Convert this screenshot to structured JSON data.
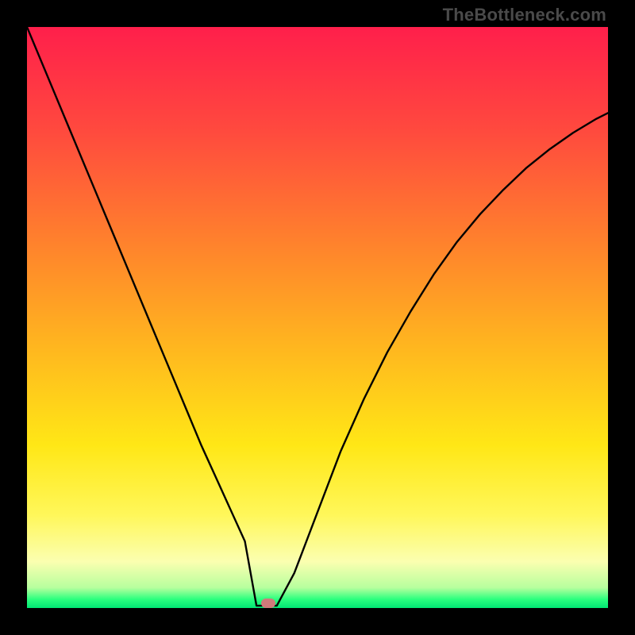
{
  "watermark": "TheBottleneck.com",
  "colors": {
    "frame": "#000000",
    "gradient_stops": [
      {
        "pos": 0.0,
        "color": "#ff1f4b"
      },
      {
        "pos": 0.18,
        "color": "#ff4a3e"
      },
      {
        "pos": 0.4,
        "color": "#ff8a2a"
      },
      {
        "pos": 0.55,
        "color": "#ffb61f"
      },
      {
        "pos": 0.72,
        "color": "#ffe716"
      },
      {
        "pos": 0.84,
        "color": "#fff75a"
      },
      {
        "pos": 0.92,
        "color": "#fbffb0"
      },
      {
        "pos": 0.965,
        "color": "#b7ff9e"
      },
      {
        "pos": 0.985,
        "color": "#2bff7e"
      },
      {
        "pos": 1.0,
        "color": "#00e674"
      }
    ]
  },
  "chart_data": {
    "type": "line",
    "title": "",
    "xlabel": "",
    "ylabel": "",
    "x_range": [
      0,
      1
    ],
    "y_range": [
      0,
      1
    ],
    "series": [
      {
        "name": "curve",
        "x": [
          0.0,
          0.025,
          0.05,
          0.075,
          0.1,
          0.125,
          0.15,
          0.175,
          0.2,
          0.225,
          0.25,
          0.275,
          0.3,
          0.325,
          0.35,
          0.375,
          0.4,
          0.42,
          0.46,
          0.5,
          0.54,
          0.58,
          0.62,
          0.66,
          0.7,
          0.74,
          0.78,
          0.82,
          0.86,
          0.9,
          0.94,
          0.98,
          1.0
        ],
        "y": [
          1.0,
          0.94,
          0.88,
          0.82,
          0.76,
          0.7,
          0.64,
          0.58,
          0.52,
          0.46,
          0.4,
          0.34,
          0.28,
          0.225,
          0.17,
          0.115,
          0.06,
          0.02,
          0.06,
          0.165,
          0.27,
          0.36,
          0.44,
          0.51,
          0.574,
          0.63,
          0.678,
          0.72,
          0.758,
          0.79,
          0.818,
          0.842,
          0.852
        ]
      }
    ],
    "marker": {
      "x": 0.415,
      "y": 0.008
    },
    "flat_bottom_x": [
      0.395,
      0.43
    ]
  }
}
